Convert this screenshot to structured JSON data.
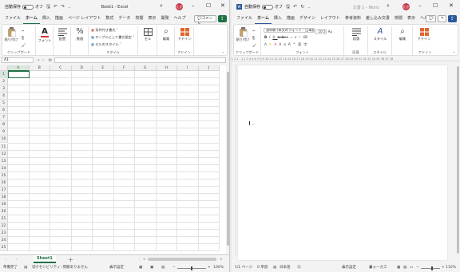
{
  "excel": {
    "autosave_label": "自動保存",
    "autosave_state": "オフ",
    "title": "Book1 - Excel",
    "avatar": "たか",
    "tabs": [
      "ファイル",
      "ホーム",
      "挿入",
      "描画",
      "ページ レイアウト",
      "数式",
      "データ",
      "校閲",
      "表示",
      "開発",
      "ヘルプ"
    ],
    "active_tab": "ホーム",
    "comment_button": "コメント",
    "ribbon": {
      "paste": "貼り付け",
      "clipboard": "クリップボード",
      "font": "フォント",
      "alignment": "配置",
      "number": "数値",
      "conditional": "条件付き書式 ˅",
      "table": "テーブルとして書式設定 ˅",
      "cellstyle": "セルのスタイル ˅",
      "styles": "スタイル",
      "cells": "セル",
      "editing": "編集",
      "addins": "アドイン",
      "addins_group": "アドイン"
    },
    "namebox": "A1",
    "fx": "fx",
    "columns": [
      "A",
      "B",
      "C",
      "D",
      "E",
      "F",
      "G",
      "H",
      "I",
      "J"
    ],
    "rows": [
      "1",
      "2",
      "3",
      "4",
      "5",
      "6",
      "7",
      "8",
      "9",
      "10",
      "11",
      "12",
      "13",
      "14",
      "15",
      "16",
      "17",
      "18",
      "19",
      "20",
      "21",
      "22",
      "23",
      "24",
      "25"
    ],
    "sheet_tab": "Sheet1",
    "status": {
      "ready": "準備完了",
      "accessibility": "アクセシビリティ: 問題ありません",
      "display": "表示設定",
      "zoom": "100%"
    }
  },
  "word": {
    "autosave_label": "自動保存",
    "autosave_state": "オフ",
    "title": "文書 1 - Word",
    "avatar": "たか",
    "tabs": [
      "ファイル",
      "ホーム",
      "挿入",
      "描画",
      "デザイン",
      "レイアウト",
      "参考資料",
      "差し込み文書",
      "校閲",
      "表示",
      "ヘルプ"
    ],
    "active_tab": "ホーム",
    "ribbon": {
      "paste": "貼り付け",
      "clipboard": "クリップボード",
      "font_name": "游明朝 (本文のフォント - 日本語)",
      "font_size": "10.5",
      "font_group": "フォント",
      "paragraph": "段落",
      "paragraph_group": "段落",
      "styles": "スタイル",
      "styles_group": "スタイル",
      "editing": "編集",
      "addins": "アドイン",
      "addins_group": "アドイン"
    },
    "ruler": "L  2  1  .  1  2  3  4  5  6  7  8  9  10  11  12  13  14  15  16  17  18  19  20  21  22  23  24  25  26  27  28  29  30  31  32  33  34  35  36  37  38",
    "status": {
      "page": "1/1 ページ",
      "words": "0 単語",
      "language": "日本語",
      "display": "表示設定",
      "focus": "フォーカス",
      "zoom": "110%"
    }
  },
  "colors": {
    "excel_accent": "#1e7145",
    "word_accent": "#2b579a",
    "avatar": "#c73a48"
  }
}
